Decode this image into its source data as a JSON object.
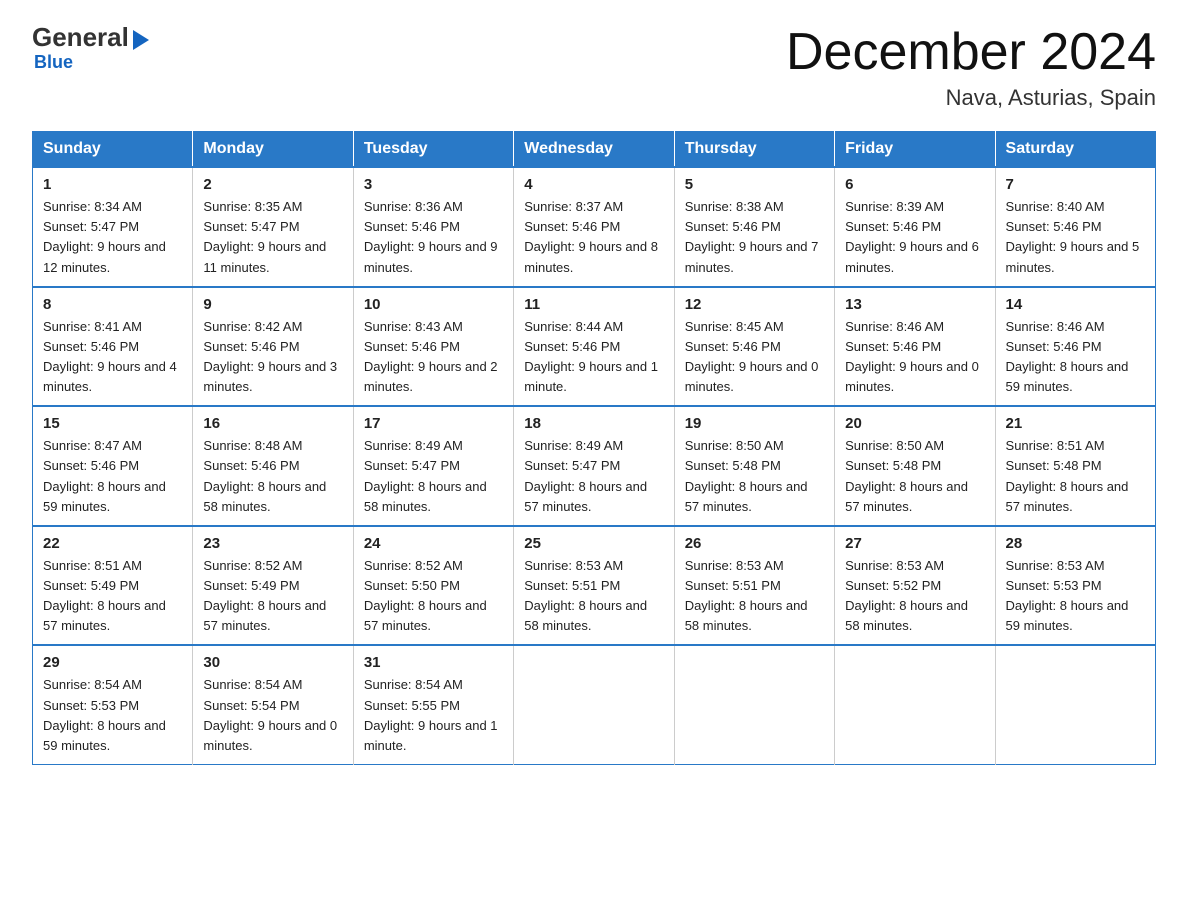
{
  "logo": {
    "general": "General",
    "blue": "Blue",
    "tagline": "Blue"
  },
  "header": {
    "title": "December 2024",
    "subtitle": "Nava, Asturias, Spain"
  },
  "days_of_week": [
    "Sunday",
    "Monday",
    "Tuesday",
    "Wednesday",
    "Thursday",
    "Friday",
    "Saturday"
  ],
  "weeks": [
    [
      {
        "day": "1",
        "sunrise": "8:34 AM",
        "sunset": "5:47 PM",
        "daylight": "9 hours and 12 minutes."
      },
      {
        "day": "2",
        "sunrise": "8:35 AM",
        "sunset": "5:47 PM",
        "daylight": "9 hours and 11 minutes."
      },
      {
        "day": "3",
        "sunrise": "8:36 AM",
        "sunset": "5:46 PM",
        "daylight": "9 hours and 9 minutes."
      },
      {
        "day": "4",
        "sunrise": "8:37 AM",
        "sunset": "5:46 PM",
        "daylight": "9 hours and 8 minutes."
      },
      {
        "day": "5",
        "sunrise": "8:38 AM",
        "sunset": "5:46 PM",
        "daylight": "9 hours and 7 minutes."
      },
      {
        "day": "6",
        "sunrise": "8:39 AM",
        "sunset": "5:46 PM",
        "daylight": "9 hours and 6 minutes."
      },
      {
        "day": "7",
        "sunrise": "8:40 AM",
        "sunset": "5:46 PM",
        "daylight": "9 hours and 5 minutes."
      }
    ],
    [
      {
        "day": "8",
        "sunrise": "8:41 AM",
        "sunset": "5:46 PM",
        "daylight": "9 hours and 4 minutes."
      },
      {
        "day": "9",
        "sunrise": "8:42 AM",
        "sunset": "5:46 PM",
        "daylight": "9 hours and 3 minutes."
      },
      {
        "day": "10",
        "sunrise": "8:43 AM",
        "sunset": "5:46 PM",
        "daylight": "9 hours and 2 minutes."
      },
      {
        "day": "11",
        "sunrise": "8:44 AM",
        "sunset": "5:46 PM",
        "daylight": "9 hours and 1 minute."
      },
      {
        "day": "12",
        "sunrise": "8:45 AM",
        "sunset": "5:46 PM",
        "daylight": "9 hours and 0 minutes."
      },
      {
        "day": "13",
        "sunrise": "8:46 AM",
        "sunset": "5:46 PM",
        "daylight": "9 hours and 0 minutes."
      },
      {
        "day": "14",
        "sunrise": "8:46 AM",
        "sunset": "5:46 PM",
        "daylight": "8 hours and 59 minutes."
      }
    ],
    [
      {
        "day": "15",
        "sunrise": "8:47 AM",
        "sunset": "5:46 PM",
        "daylight": "8 hours and 59 minutes."
      },
      {
        "day": "16",
        "sunrise": "8:48 AM",
        "sunset": "5:46 PM",
        "daylight": "8 hours and 58 minutes."
      },
      {
        "day": "17",
        "sunrise": "8:49 AM",
        "sunset": "5:47 PM",
        "daylight": "8 hours and 58 minutes."
      },
      {
        "day": "18",
        "sunrise": "8:49 AM",
        "sunset": "5:47 PM",
        "daylight": "8 hours and 57 minutes."
      },
      {
        "day": "19",
        "sunrise": "8:50 AM",
        "sunset": "5:48 PM",
        "daylight": "8 hours and 57 minutes."
      },
      {
        "day": "20",
        "sunrise": "8:50 AM",
        "sunset": "5:48 PM",
        "daylight": "8 hours and 57 minutes."
      },
      {
        "day": "21",
        "sunrise": "8:51 AM",
        "sunset": "5:48 PM",
        "daylight": "8 hours and 57 minutes."
      }
    ],
    [
      {
        "day": "22",
        "sunrise": "8:51 AM",
        "sunset": "5:49 PM",
        "daylight": "8 hours and 57 minutes."
      },
      {
        "day": "23",
        "sunrise": "8:52 AM",
        "sunset": "5:49 PM",
        "daylight": "8 hours and 57 minutes."
      },
      {
        "day": "24",
        "sunrise": "8:52 AM",
        "sunset": "5:50 PM",
        "daylight": "8 hours and 57 minutes."
      },
      {
        "day": "25",
        "sunrise": "8:53 AM",
        "sunset": "5:51 PM",
        "daylight": "8 hours and 58 minutes."
      },
      {
        "day": "26",
        "sunrise": "8:53 AM",
        "sunset": "5:51 PM",
        "daylight": "8 hours and 58 minutes."
      },
      {
        "day": "27",
        "sunrise": "8:53 AM",
        "sunset": "5:52 PM",
        "daylight": "8 hours and 58 minutes."
      },
      {
        "day": "28",
        "sunrise": "8:53 AM",
        "sunset": "5:53 PM",
        "daylight": "8 hours and 59 minutes."
      }
    ],
    [
      {
        "day": "29",
        "sunrise": "8:54 AM",
        "sunset": "5:53 PM",
        "daylight": "8 hours and 59 minutes."
      },
      {
        "day": "30",
        "sunrise": "8:54 AM",
        "sunset": "5:54 PM",
        "daylight": "9 hours and 0 minutes."
      },
      {
        "day": "31",
        "sunrise": "8:54 AM",
        "sunset": "5:55 PM",
        "daylight": "9 hours and 1 minute."
      },
      {
        "day": "",
        "sunrise": "",
        "sunset": "",
        "daylight": ""
      },
      {
        "day": "",
        "sunrise": "",
        "sunset": "",
        "daylight": ""
      },
      {
        "day": "",
        "sunrise": "",
        "sunset": "",
        "daylight": ""
      },
      {
        "day": "",
        "sunrise": "",
        "sunset": "",
        "daylight": ""
      }
    ]
  ]
}
